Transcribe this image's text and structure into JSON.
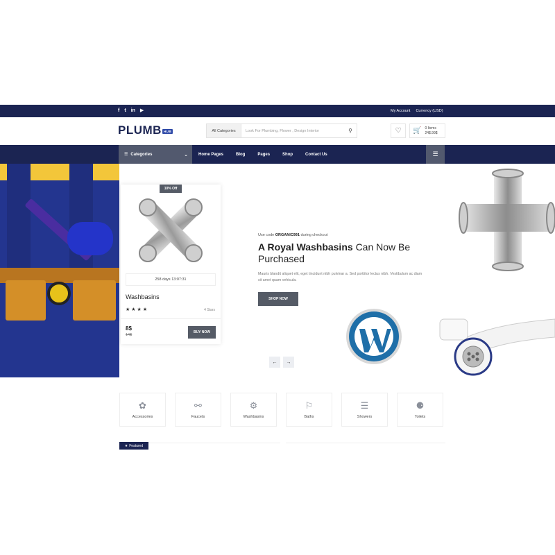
{
  "topbar": {
    "social": [
      "f",
      "t",
      "in",
      "▶"
    ],
    "account": "My Account",
    "currency": "Currency (USD)"
  },
  "header": {
    "logo": "PLUMB",
    "logo_badge": "HUB",
    "search_category": "All Categories",
    "search_placeholder": "Look For Plumbing, Flower , Design Interior",
    "cart_items": "0 Items",
    "cart_total": "24$.99$"
  },
  "nav": {
    "categories_label": "Categories",
    "menu": [
      "Home Pages",
      "Blog",
      "Pages",
      "Shop",
      "Contact Us"
    ]
  },
  "product_card": {
    "badge": "10% Off",
    "timer": "258 days 13:07:31",
    "title": "Washbasins",
    "stars": "★★★★",
    "stars_count": "4 Stars",
    "price": "8$",
    "old_price": "14$",
    "buy_label": "BUY NOW"
  },
  "hero": {
    "code_prefix": "Use code",
    "code": "ORGANIC991",
    "code_suffix": "during checkout",
    "headline_bold": "A Royal Washbasins",
    "headline_rest": "Can Now Be Purchased",
    "description": "Mauris blandit aliquet elit, eget tincidunt nibh pulvinar a. Sed porttitor lectus nibh. Vestibulum ac diam sit amet quam vehicula.",
    "shop_label": "SHOP NOW"
  },
  "categories": [
    {
      "label": "Accessories",
      "icon": "leaf-icon"
    },
    {
      "label": "Faucets",
      "icon": "faucet-icon"
    },
    {
      "label": "Washbasins",
      "icon": "washbasin-icon"
    },
    {
      "label": "Baths",
      "icon": "bath-icon"
    },
    {
      "label": "Showers",
      "icon": "shower-icon"
    },
    {
      "label": "Toilets",
      "icon": "toilet-icon"
    }
  ],
  "featured_label": "Featured",
  "colors": {
    "navy": "#1b2452",
    "slate": "#52596e",
    "button": "#555b66"
  }
}
